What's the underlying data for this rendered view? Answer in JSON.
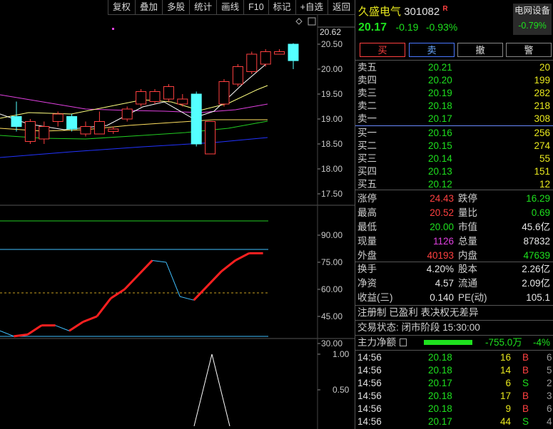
{
  "toolbar": [
    "复权",
    "叠加",
    "多股",
    "统计",
    "画线",
    "F10",
    "标记",
    "+自选",
    "返回"
  ],
  "stock": {
    "name": "久盛电气",
    "code": "301082",
    "badge": "R",
    "price": "20.17",
    "change": "-0.19",
    "change_pct": "-0.93%",
    "sector": "电网设备",
    "sector_pct": "-0.79%"
  },
  "actions": [
    "买",
    "卖",
    "撤",
    "警"
  ],
  "sell_orders": [
    {
      "label": "卖五",
      "price": "20.21",
      "vol": "20"
    },
    {
      "label": "卖四",
      "price": "20.20",
      "vol": "199"
    },
    {
      "label": "卖三",
      "price": "20.19",
      "vol": "282"
    },
    {
      "label": "卖二",
      "price": "20.18",
      "vol": "218"
    },
    {
      "label": "卖一",
      "price": "20.17",
      "vol": "308"
    }
  ],
  "buy_orders": [
    {
      "label": "买一",
      "price": "20.16",
      "vol": "256"
    },
    {
      "label": "买二",
      "price": "20.15",
      "vol": "274"
    },
    {
      "label": "买三",
      "price": "20.14",
      "vol": "55"
    },
    {
      "label": "买四",
      "price": "20.13",
      "vol": "151"
    },
    {
      "label": "买五",
      "price": "20.12",
      "vol": "12"
    }
  ],
  "stats1": [
    {
      "l1": "涨停",
      "v1": "24.43",
      "c1": "red",
      "l2": "跌停",
      "v2": "16.29",
      "c2": "green"
    },
    {
      "l1": "最高",
      "v1": "20.52",
      "c1": "red",
      "l2": "量比",
      "v2": "0.69",
      "c2": "green"
    },
    {
      "l1": "最低",
      "v1": "20.00",
      "c1": "green",
      "l2": "市值",
      "v2": "45.6亿",
      "c2": "white"
    },
    {
      "l1": "现量",
      "v1": "1126",
      "c1": "magenta",
      "l2": "总量",
      "v2": "87832",
      "c2": "white"
    },
    {
      "l1": "外盘",
      "v1": "40193",
      "c1": "red",
      "l2": "内盘",
      "v2": "47639",
      "c2": "green"
    }
  ],
  "stats2": [
    {
      "l1": "换手",
      "v1": "4.20%",
      "c1": "white",
      "l2": "股本",
      "v2": "2.26亿",
      "c2": "white"
    },
    {
      "l1": "净资",
      "v1": "4.57",
      "c1": "white",
      "l2": "流通",
      "v2": "2.09亿",
      "c2": "white"
    },
    {
      "l1": "收益(三)",
      "v1": "0.140",
      "c1": "white",
      "l2": "PE(动)",
      "v2": "105.1",
      "c2": "white"
    }
  ],
  "info_line": "注册制 已盈利 表决权无差异",
  "trade_status": "交易状态: 闭市阶段 15:30:00",
  "main_flow": {
    "label": "主力净额",
    "value": "-755.0万",
    "pct": "-4%"
  },
  "ticks": [
    {
      "time": "14:56",
      "price": "20.18",
      "qty": "16",
      "side": "B",
      "n": "6"
    },
    {
      "time": "14:56",
      "price": "20.18",
      "qty": "14",
      "side": "B",
      "n": "5"
    },
    {
      "time": "14:56",
      "price": "20.17",
      "qty": "6",
      "side": "S",
      "n": "2"
    },
    {
      "time": "14:56",
      "price": "20.18",
      "qty": "17",
      "side": "B",
      "n": "3"
    },
    {
      "time": "14:56",
      "price": "20.18",
      "qty": "9",
      "side": "B",
      "n": "6"
    },
    {
      "time": "14:56",
      "price": "20.17",
      "qty": "44",
      "side": "S",
      "n": "4"
    }
  ],
  "chart_data": {
    "type": "candlestick",
    "price_axis": {
      "ticks": [
        "20.50",
        "20.00",
        "19.50",
        "19.00",
        "18.50",
        "18.00",
        "17.50"
      ],
      "current": "20.62"
    },
    "candles": [
      {
        "o": 19.05,
        "c": 18.85,
        "h": 19.35,
        "l": 18.75
      },
      {
        "o": 18.55,
        "c": 18.95,
        "h": 19.0,
        "l": 18.5
      },
      {
        "o": 18.6,
        "c": 18.85,
        "h": 18.95,
        "l": 18.5
      },
      {
        "o": 18.95,
        "c": 19.1,
        "h": 19.15,
        "l": 18.85
      },
      {
        "o": 19.05,
        "c": 18.8,
        "h": 19.1,
        "l": 18.75
      },
      {
        "o": 18.7,
        "c": 18.85,
        "h": 18.95,
        "l": 18.65
      },
      {
        "o": 18.7,
        "c": 18.95,
        "h": 19.15,
        "l": 18.7
      },
      {
        "o": 18.75,
        "c": 18.8,
        "h": 18.85,
        "l": 18.7
      },
      {
        "o": 19.0,
        "c": 19.2,
        "h": 19.25,
        "l": 18.95
      },
      {
        "o": 19.3,
        "c": 19.55,
        "h": 19.6,
        "l": 19.25
      },
      {
        "o": 19.35,
        "c": 19.55,
        "h": 19.6,
        "l": 19.3
      },
      {
        "o": 19.4,
        "c": 19.65,
        "h": 19.7,
        "l": 19.35
      },
      {
        "o": 19.3,
        "c": 19.4,
        "h": 19.5,
        "l": 19.25
      },
      {
        "o": 19.5,
        "c": 18.5,
        "h": 19.55,
        "l": 18.45
      },
      {
        "o": 18.3,
        "c": 18.95,
        "h": 18.95,
        "l": 18.3
      },
      {
        "o": 19.3,
        "c": 19.75,
        "h": 19.8,
        "l": 19.25
      },
      {
        "o": 19.7,
        "c": 20.05,
        "h": 20.1,
        "l": 19.65
      },
      {
        "o": 19.95,
        "c": 20.3,
        "h": 20.35,
        "l": 19.9
      },
      {
        "o": 20.1,
        "c": 20.35,
        "h": 20.4,
        "l": 20.05
      },
      {
        "o": 20.3,
        "c": 20.35,
        "h": 20.4,
        "l": 20.3
      },
      {
        "o": 20.5,
        "c": 20.17,
        "h": 20.52,
        "l": 20.0
      }
    ],
    "indicator_axis": {
      "ticks": [
        "90.00",
        "75.00",
        "60.00",
        "45.00",
        "30.00"
      ]
    },
    "indicator_values": [
      37,
      34,
      35,
      40,
      40,
      37,
      42,
      45,
      55,
      60,
      68,
      76,
      75,
      56,
      54,
      62,
      70,
      76,
      80,
      80
    ],
    "lower_axis": {
      "ticks": [
        "1.00",
        "0.50"
      ]
    }
  }
}
